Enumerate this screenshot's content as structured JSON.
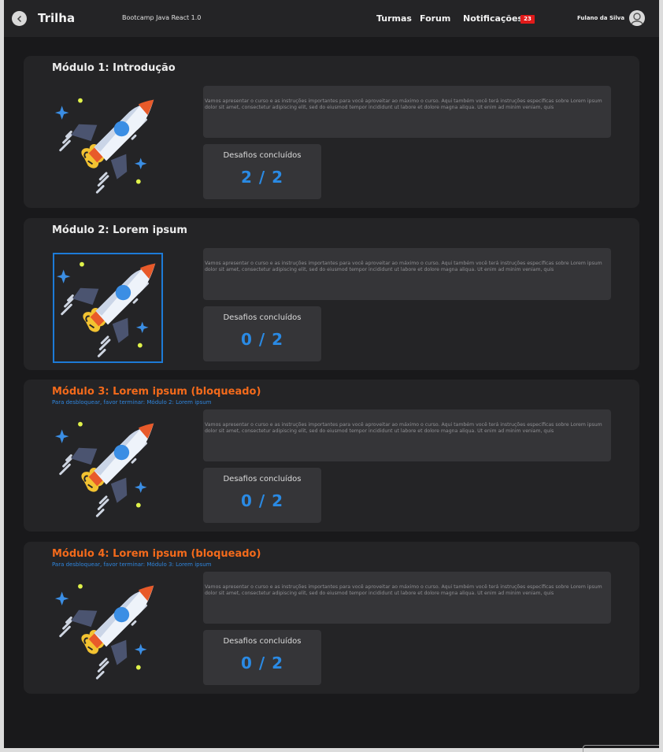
{
  "header": {
    "title": "Trilha",
    "course": "Bootcamp Java React 1.0",
    "nav": {
      "turmas": "Turmas",
      "forum": "Forum",
      "notificacoes": "Notificações"
    },
    "notification_count": "23",
    "user_name": "Fulano da Silva",
    "icons": {
      "back": "chevron-left-icon",
      "avatar": "user-avatar-icon"
    }
  },
  "modules": [
    {
      "title": "Módulo 1: Introdução",
      "locked": false,
      "unlock_note": "",
      "description": "Vamos apresentar o curso e as instruções importantes para você aproveitar ao máximo o curso. Aqui também você terá instruções específicas sobre Lorem ipsum dolor sit amet, consectetur adipiscing elit, sed do eiusmod tempor incididunt ut labore et dolore magna aliqua. Ut enim ad minim veniam, quis",
      "challenges_label": "Desafios concluídos",
      "challenges": "2 / 2"
    },
    {
      "title": "Módulo 2: Lorem ipsum",
      "locked": false,
      "unlock_note": "",
      "description": "Vamos apresentar o curso e as instruções importantes para você aproveitar ao máximo o curso. Aqui também você terá instruções específicas sobre Lorem ipsum dolor sit amet, consectetur adipiscing elit, sed do eiusmod tempor incididunt ut labore et dolore magna aliqua. Ut enim ad minim veniam, quis",
      "challenges_label": "Desafios concluídos",
      "challenges": "0 / 2"
    },
    {
      "title": "Módulo 3: Lorem ipsum (bloqueado)",
      "locked": true,
      "unlock_note": "Para desbloquear, favor terminar: Módulo 2: Lorem ipsum",
      "description": "Vamos apresentar o curso e as instruções importantes para você aproveitar ao máximo o curso. Aqui também você terá instruções específicas sobre Lorem ipsum dolor sit amet, consectetur adipiscing elit, sed do eiusmod tempor incididunt ut labore et dolore magna aliqua. Ut enim ad minim veniam, quis",
      "challenges_label": "Desafios concluídos",
      "challenges": "0 / 2"
    },
    {
      "title": "Módulo 4: Lorem ipsum (bloqueado)",
      "locked": true,
      "unlock_note": "Para desbloquear, favor terminar: Módulo 3: Lorem ipsum",
      "description": "Vamos apresentar o curso e as instruções importantes para você aproveitar ao máximo o curso. Aqui também você terá instruções específicas sobre Lorem ipsum dolor sit amet, consectetur adipiscing elit, sed do eiusmod tempor incididunt ut labore et dolore magna aliqua. Ut enim ad minim veniam, quis",
      "challenges_label": "Desafios concluídos",
      "challenges": "0 / 2"
    }
  ],
  "colors": {
    "background": "#19191b",
    "card": "#242426",
    "panel": "#353538",
    "locked_title": "#f36a1b",
    "accent_blue": "#2a8ae4",
    "badge_red": "#e11a1a"
  }
}
